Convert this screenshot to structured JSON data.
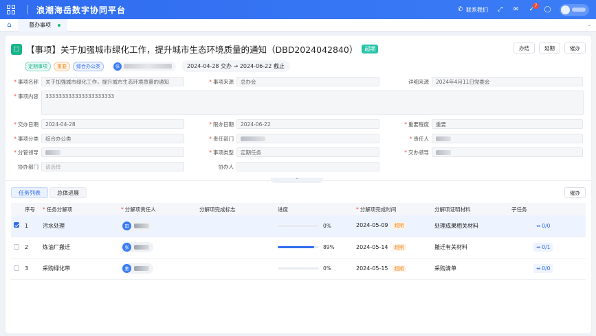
{
  "topbar": {
    "app_title": "浪潮海岳数字协同平台",
    "contact_label": "联系我们",
    "notification_count": "7"
  },
  "tabbar": {
    "tab_label": "督办事项"
  },
  "header": {
    "title": "【事项】关于加强城市绿化工作，提升城市生态环境质量的通知（DBD2024042840）",
    "status_tag": "超期",
    "actions": [
      "办结",
      "延期",
      "催办"
    ],
    "tags": [
      "定期事项",
      "重要",
      "综合办公类"
    ],
    "owner_avatar": "张",
    "date_range": "2024-04-28 交办 → 2024-06-22 截止"
  },
  "form": {
    "item_name_label": "事项名称",
    "item_name_value": "关于加强城市绿化工作，提升城市生态环境质量的通知",
    "source_label": "事项来源",
    "source_value": "总办会",
    "detail_source_label": "详细来源",
    "detail_source_value": "2024年4月11日党委会",
    "content_label": "事项内容",
    "content_value": "333333333333333333333",
    "assign_date_label": "交办日期",
    "assign_date_value": "2024-04-28",
    "deadline_label": "限办日期",
    "deadline_value": "2024-06-22",
    "importance_label": "重要程度",
    "importance_value": "重要",
    "category_label": "事项分类",
    "category_value": "综合办公类",
    "dept_label": "责任部门",
    "responsible_label": "责任人",
    "leader_label": "分管领导",
    "type_label": "事项类型",
    "type_value": "定期任务",
    "assign_leader_label": "交办领导",
    "assist_dept_label": "协办部门",
    "assist_dept_placeholder": "请选择",
    "assistant_label": "协办人"
  },
  "tasks": {
    "tabs": [
      "任务列表",
      "总体进展"
    ],
    "urge_button": "催办",
    "columns": [
      "序号",
      "任务分解项",
      "分解项责任人",
      "分解项完成标志",
      "进度",
      "分解项完成时间",
      "分解项证明材料",
      "子任务"
    ],
    "overdue_label": "超期",
    "rows": [
      {
        "index": "1",
        "name": "污水处理",
        "avatar": "田",
        "progress": 0,
        "progress_text": "0%",
        "due": "2024-05-09",
        "material": "处理成果相关材料",
        "subtasks": "0/0",
        "selected": true
      },
      {
        "index": "2",
        "name": "炼油厂搬迁",
        "avatar": "张",
        "progress": 89,
        "progress_text": "89%",
        "due": "2024-05-14",
        "material": "搬迁有关材料",
        "subtasks": "0/1",
        "selected": false
      },
      {
        "index": "3",
        "name": "采购绿化带",
        "avatar": "董",
        "progress": 0,
        "progress_text": "0%",
        "due": "2024-05-15",
        "material": "采购清单",
        "subtasks": "0/0",
        "selected": false
      }
    ]
  }
}
